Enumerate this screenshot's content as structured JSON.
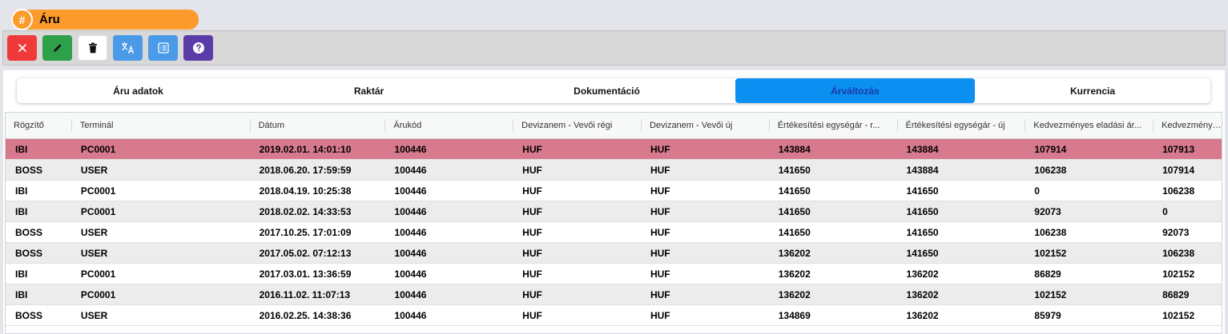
{
  "window": {
    "title": "Áru",
    "title_icon": "#"
  },
  "toolbar": {
    "buttons": [
      {
        "name": "close",
        "icon": "close-icon",
        "color": "#f03a3a"
      },
      {
        "name": "edit",
        "icon": "pencil-icon",
        "color": "#2fa04a"
      },
      {
        "name": "delete",
        "icon": "trash-icon",
        "color": "#ffffff"
      },
      {
        "name": "translate",
        "icon": "translate-icon",
        "color": "#4a9ae8"
      },
      {
        "name": "list",
        "icon": "list-icon",
        "color": "#4a9ae8"
      },
      {
        "name": "help",
        "icon": "help-icon",
        "color": "#5a3ca8"
      }
    ]
  },
  "tabs": [
    {
      "label": "Áru adatok",
      "active": false
    },
    {
      "label": "Raktár",
      "active": false
    },
    {
      "label": "Dokumentáció",
      "active": false
    },
    {
      "label": "Árváltozás",
      "active": true
    },
    {
      "label": "Kurrencia",
      "active": false
    }
  ],
  "table": {
    "columns": [
      "Rögzítő",
      "Terminál",
      "Dátum",
      "Árukód",
      "Devizanem - Vevői régi",
      "Devizanem - Vevői új",
      "Értékesítési egységár - r...",
      "Értékesítési egységár - új",
      "Kedvezményes eladási ár...",
      "Kedvezményes"
    ],
    "rows": [
      [
        "IBI",
        "PC0001",
        "2019.02.01. 14:01:10",
        "100446",
        "HUF",
        "HUF",
        "143884",
        "143884",
        "107914",
        "107913"
      ],
      [
        "BOSS",
        "USER",
        "2018.06.20. 17:59:59",
        "100446",
        "HUF",
        "HUF",
        "141650",
        "143884",
        "106238",
        "107914"
      ],
      [
        "IBI",
        "PC0001",
        "2018.04.19. 10:25:38",
        "100446",
        "HUF",
        "HUF",
        "141650",
        "141650",
        "0",
        "106238"
      ],
      [
        "IBI",
        "PC0001",
        "2018.02.02. 14:33:53",
        "100446",
        "HUF",
        "HUF",
        "141650",
        "141650",
        "92073",
        "0"
      ],
      [
        "BOSS",
        "USER",
        "2017.10.25. 17:01:09",
        "100446",
        "HUF",
        "HUF",
        "141650",
        "141650",
        "106238",
        "92073"
      ],
      [
        "BOSS",
        "USER",
        "2017.05.02. 07:12:13",
        "100446",
        "HUF",
        "HUF",
        "136202",
        "141650",
        "102152",
        "106238"
      ],
      [
        "IBI",
        "PC0001",
        "2017.03.01. 13:36:59",
        "100446",
        "HUF",
        "HUF",
        "136202",
        "136202",
        "86829",
        "102152"
      ],
      [
        "IBI",
        "PC0001",
        "2016.11.02. 11:07:13",
        "100446",
        "HUF",
        "HUF",
        "136202",
        "136202",
        "102152",
        "86829"
      ],
      [
        "BOSS",
        "USER",
        "2016.02.25. 14:38:36",
        "100446",
        "HUF",
        "HUF",
        "134869",
        "136202",
        "85979",
        "102152"
      ]
    ],
    "selected_row": 0
  },
  "colors": {
    "accent": "#fb9b2c",
    "active_tab": "#0b8ff0",
    "selected_row": "#d87a8e"
  }
}
